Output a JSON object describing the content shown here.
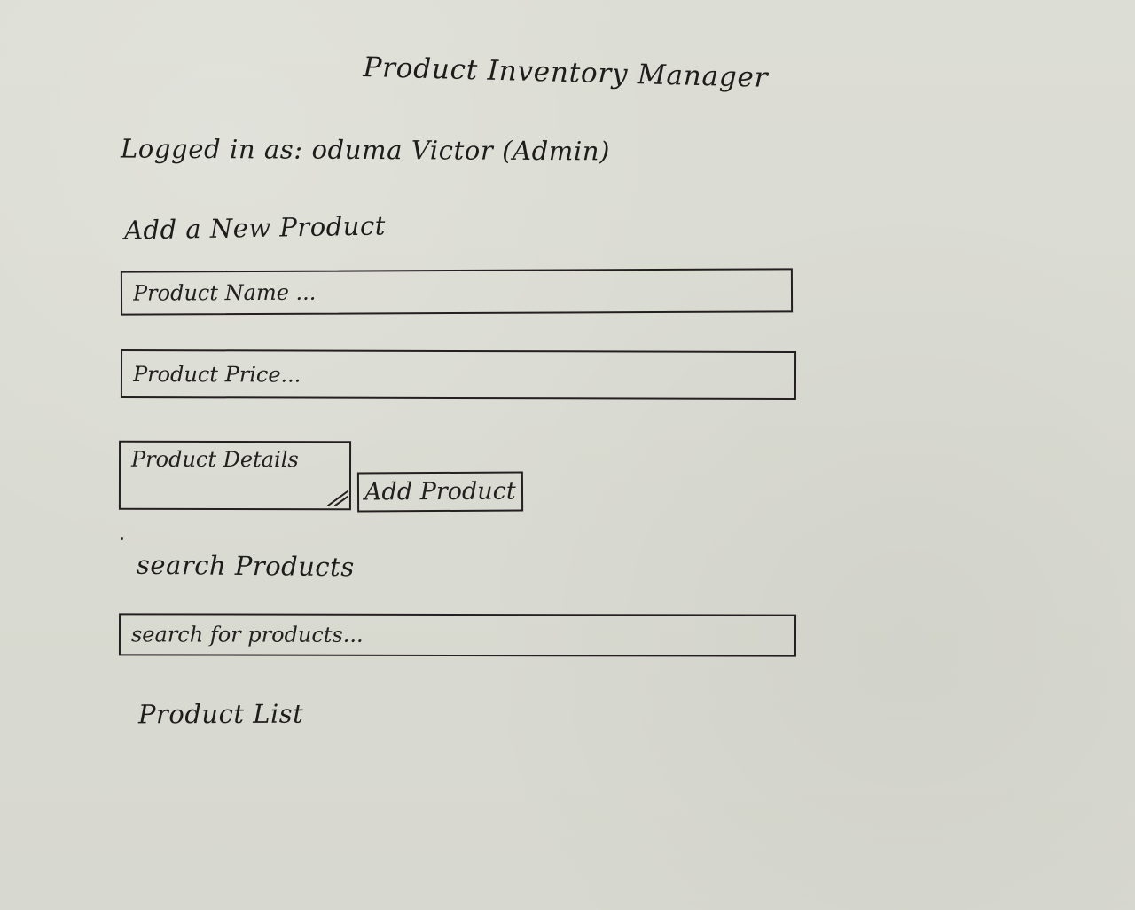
{
  "header": {
    "title": "Product Inventory Manager",
    "logged_in": "Logged in as: oduma Victor (Admin)"
  },
  "add_product": {
    "title": "Add a New Product",
    "name_placeholder": "Product Name ...",
    "price_placeholder": "Product Price...",
    "details_placeholder": "Product Details",
    "button_label": "Add Product"
  },
  "search": {
    "title": "search Products",
    "placeholder": "search for products..."
  },
  "list": {
    "title": "Product List"
  }
}
